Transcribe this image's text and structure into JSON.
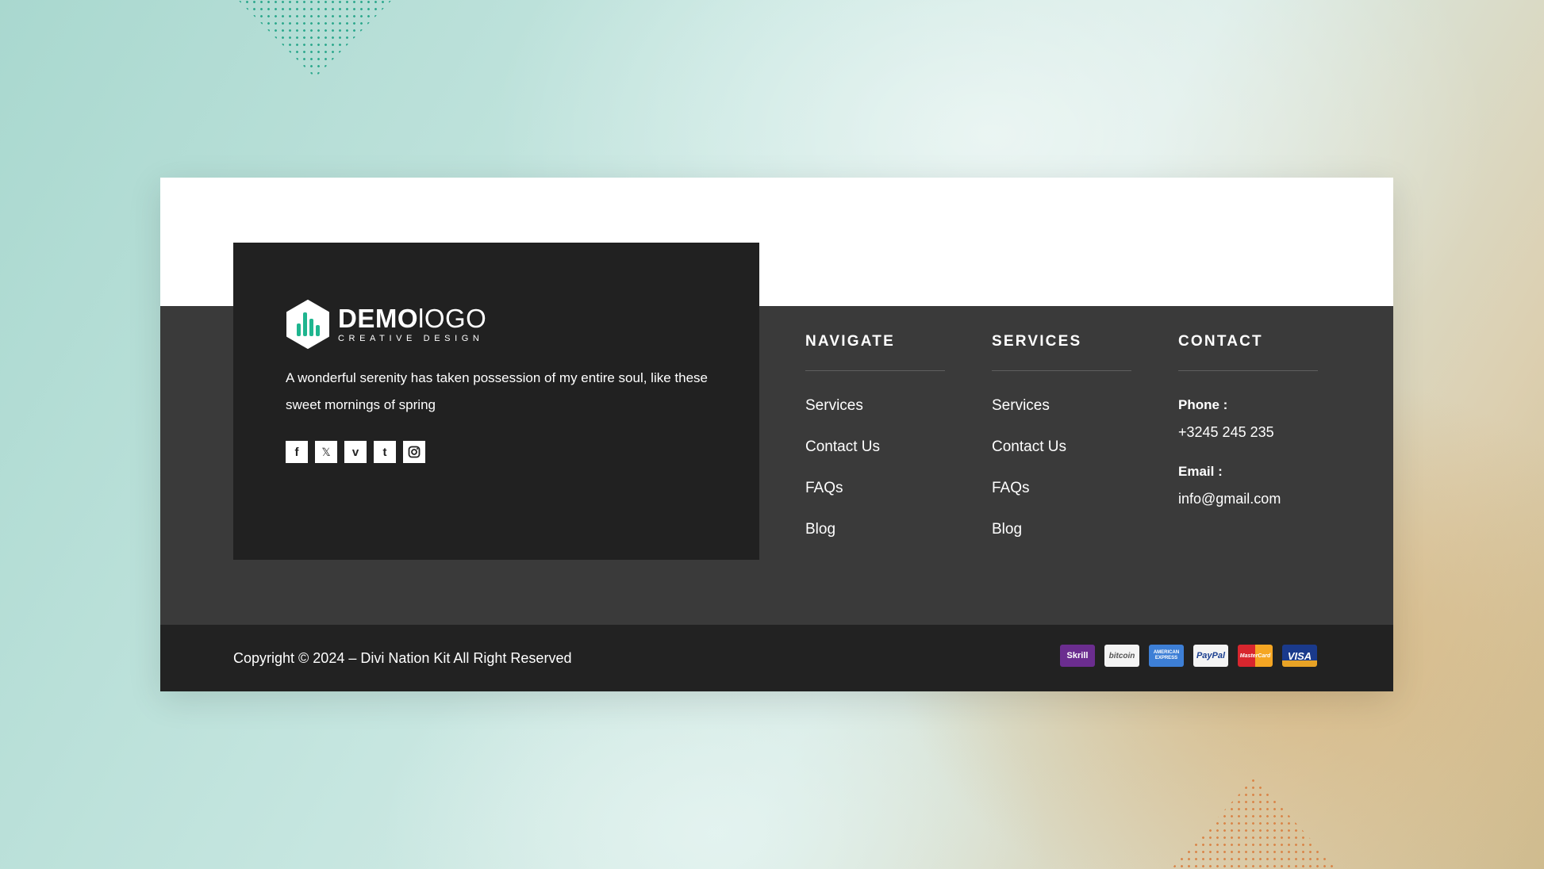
{
  "brand": {
    "name_bold": "DEMO",
    "name_light": "lOGO",
    "tagline": "CREATIVE DESIGN",
    "accent": "#1fb58f"
  },
  "about": {
    "text": "A wonderful serenity has taken possession of my entire soul, like these sweet mornings of spring"
  },
  "socials": [
    {
      "icon": "facebook-icon",
      "glyph": "f"
    },
    {
      "icon": "x-icon",
      "glyph": "𝕏"
    },
    {
      "icon": "vimeo-icon",
      "glyph": "v"
    },
    {
      "icon": "tumblr-icon",
      "glyph": "t"
    },
    {
      "icon": "instagram-icon",
      "glyph": ""
    }
  ],
  "navigate": {
    "title": "NAVIGATE",
    "items": [
      "Services",
      "Contact Us",
      "FAQs",
      "Blog"
    ]
  },
  "services": {
    "title": "SERVICES",
    "items": [
      "Services",
      "Contact Us",
      "FAQs",
      "Blog"
    ]
  },
  "contact": {
    "title": "CONTACT",
    "phone_label": "Phone :",
    "phone": "+3245 245 235",
    "email_label": "Email :",
    "email": "info@gmail.com"
  },
  "footer": {
    "copyright": "Copyright © 2024 – Divi Nation Kit All Right Reserved",
    "payments": [
      {
        "name": "skrill",
        "label": "Skrill",
        "bg": "#6b2d8f",
        "fg": "#ffffff"
      },
      {
        "name": "bitcoin",
        "label": "bitcoin",
        "bg": "#f4f4f4",
        "fg": "#555555"
      },
      {
        "name": "american-express",
        "label": "AMERICAN EXPRESS",
        "bg": "#3d7fd6",
        "fg": "#ffffff"
      },
      {
        "name": "paypal",
        "label": "PayPal",
        "bg": "#f4f4f4",
        "fg": "#1a3e8f"
      },
      {
        "name": "mastercard",
        "label": "MasterCard",
        "bg": "#e8a326",
        "fg": "#ffffff"
      },
      {
        "name": "visa",
        "label": "VISA",
        "bg": "#1a3a8c",
        "fg": "#ffffff"
      }
    ]
  }
}
